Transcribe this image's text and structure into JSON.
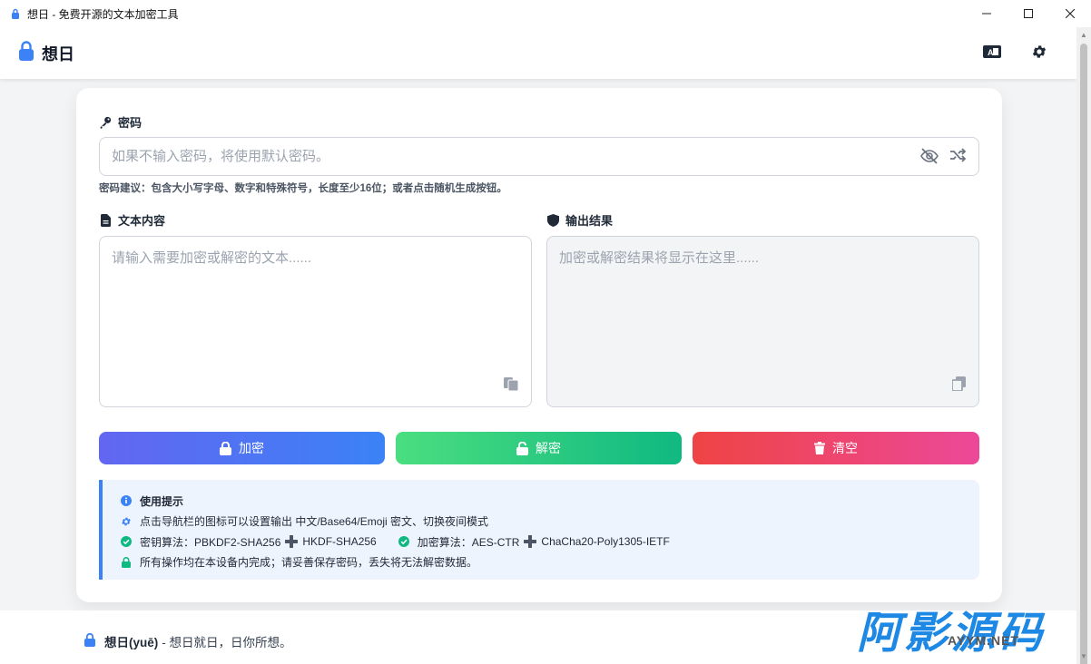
{
  "window": {
    "title": "想日 - 免费开源的文本加密工具",
    "minimize_glyph": "—",
    "maximize_glyph": "☐",
    "close_glyph": "✕"
  },
  "appbar": {
    "brand": "想日",
    "icons": [
      "language-icon",
      "gear-icon"
    ]
  },
  "password": {
    "label": "密码",
    "placeholder": "如果不输入密码，将使用默认密码。",
    "value": "",
    "hint": "密码建议：包含大小写字母、数字和特殊符号，长度至少16位；或者点击随机生成按钮。"
  },
  "input_text": {
    "label": "文本内容",
    "placeholder": "请输入需要加密或解密的文本......",
    "value": ""
  },
  "output_text": {
    "label": "输出结果",
    "placeholder": "加密或解密结果将显示在这里......",
    "value": ""
  },
  "buttons": {
    "encrypt": "加密",
    "decrypt": "解密",
    "clear": "清空"
  },
  "tips": {
    "title": "使用提示",
    "settings_tip": "点击导航栏的图标可以设置输出 中文/Base64/Emoji 密文、切换夜间模式",
    "kdf_label": "密钥算法：PBKDF2-SHA256",
    "kdf_second": "HKDF-SHA256",
    "cipher_label": "加密算法：AES-CTR",
    "cipher_second": "ChaCha20-Poly1305-IETF",
    "local_tip": "所有操作均在本设备内完成；请妥善保存密码，丢失将无法解密数据。"
  },
  "footer": {
    "name": "想日(yuē)",
    "motto": "- 想日就日，日你所想。"
  },
  "watermark": {
    "text": "阿影源码",
    "url": "AYYM.NET"
  },
  "colors": {
    "accent": "#3b82f6",
    "encrypt_from": "#6366f1",
    "encrypt_to": "#3b82f6",
    "decrypt_from": "#4ade80",
    "decrypt_to": "#10b981",
    "clear_from": "#ef4444",
    "clear_to": "#ec4899",
    "success": "#10b981"
  }
}
